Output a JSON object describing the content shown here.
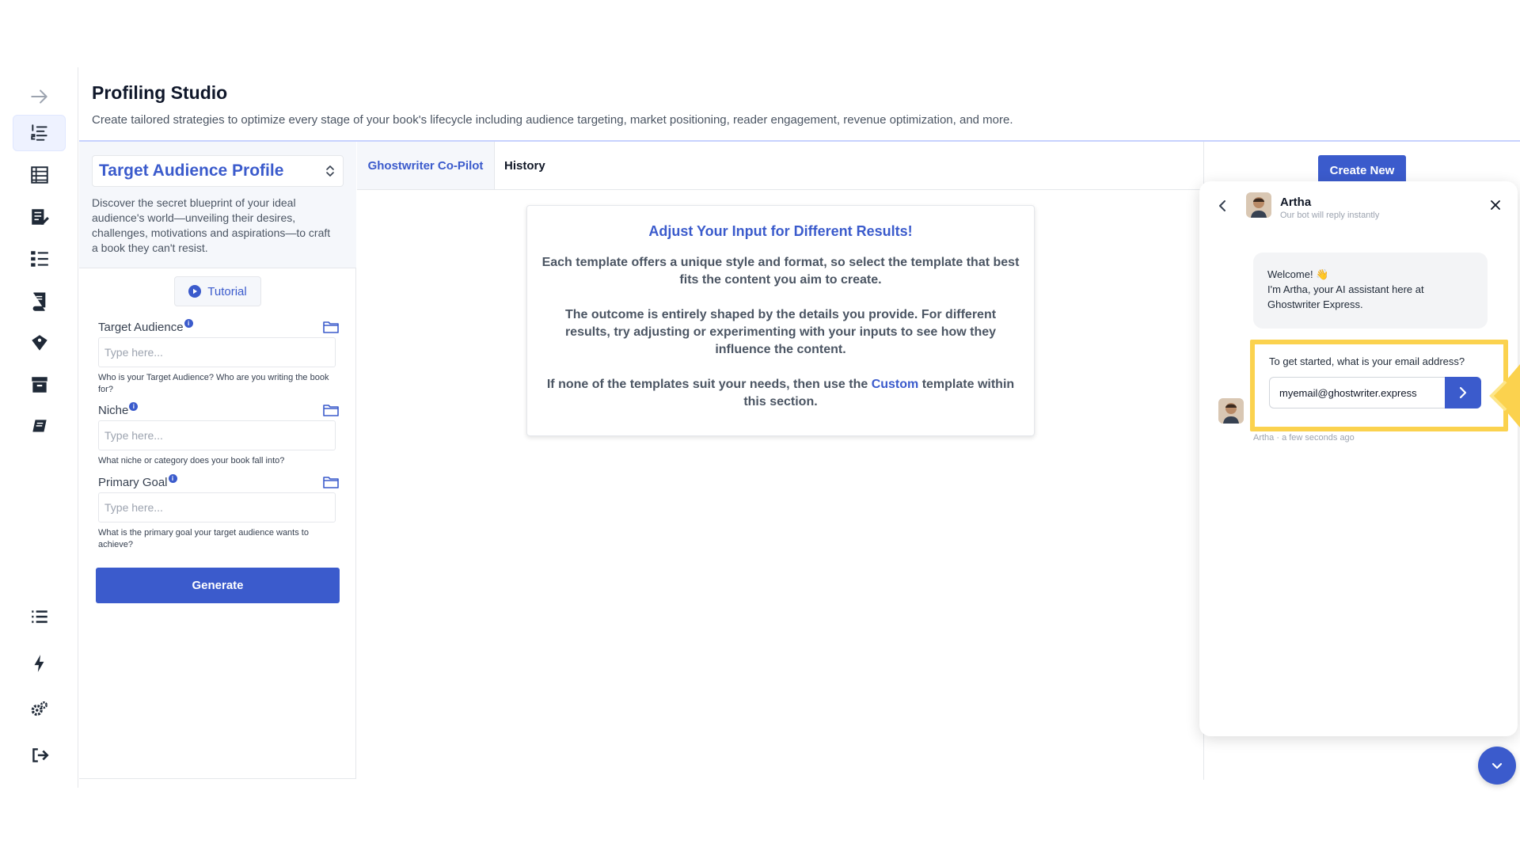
{
  "header": {
    "title": "Profiling Studio",
    "subtitle": "Create tailored strategies to optimize every stage of your book's lifecycle including audience targeting, market positioning, reader engagement, revenue optimization, and more."
  },
  "sidebar": {
    "top_icons": [
      "arrow-right-icon",
      "numbered-list-icon",
      "table-icon",
      "edit-document-icon",
      "checklist-icon",
      "book-icon",
      "tags-icon",
      "archive-icon",
      "notebook-icon"
    ],
    "bottom_icons": [
      "list-icon",
      "bolt-icon",
      "gears-icon",
      "sign-out-icon"
    ],
    "active_index": 1
  },
  "template": {
    "name": "Target Audience Profile",
    "description": "Discover the secret blueprint of your ideal audience's world—unveiling their desires, challenges, motivations and aspirations—to craft a book they can't resist.",
    "tutorial_label": "Tutorial"
  },
  "fields": [
    {
      "label": "Target Audience",
      "placeholder": "Type here...",
      "value": "",
      "help": "Who is your Target Audience? Who are you writing the book for?"
    },
    {
      "label": "Niche",
      "placeholder": "Type here...",
      "value": "",
      "help": "What niche or category does your book fall into?"
    },
    {
      "label": "Primary Goal",
      "placeholder": "Type here...",
      "value": "",
      "help": "What is the primary goal your target audience wants to achieve?"
    }
  ],
  "generate_label": "Generate",
  "tabs": [
    {
      "label": "Ghostwriter Co-Pilot",
      "active": true
    },
    {
      "label": "History",
      "active": false
    }
  ],
  "info_card": {
    "title": "Adjust Your Input for Different Results!",
    "p1": "Each template offers a unique style and format, so select the template that best fits the content you aim to create.",
    "p2": "The outcome is entirely shaped by the details you provide. For different results, try adjusting or experimenting with your inputs to see how they influence the content.",
    "p3_before": "If none of the templates suit your needs, then use the",
    "p3_link": "Custom",
    "p3_after": "template within this section."
  },
  "create_new_label": "Create New",
  "chat": {
    "bot_name": "Artha",
    "bot_status": "Our bot will reply instantly",
    "welcome_line1": "Welcome!",
    "welcome_emoji": "👋",
    "welcome_line2": "I'm Artha, your AI assistant here at Ghostwriter Express.",
    "question": "To get started, what is your email address?",
    "email_value": "myemail@ghostwriter.express",
    "meta": "Artha · a few seconds ago"
  },
  "colors": {
    "accent": "#3b5bcc",
    "highlight": "#fbd24e"
  }
}
